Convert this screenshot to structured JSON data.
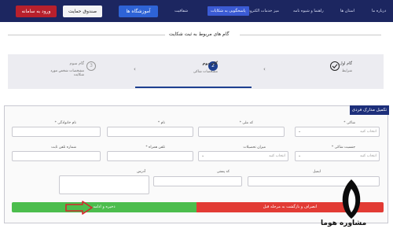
{
  "nav": {
    "login_label": "ورود به سامانه",
    "fund_label": "صندوق حمایت",
    "edu_label": "آموزشگاه ها",
    "links": [
      "درباره ما",
      "استان ها",
      "راهنما و شیوه نامه",
      "میز خدمات الکترونیکی",
      "پاسخگویی به شکایات",
      "شفافیت"
    ]
  },
  "section_title": "گام های مربوط به ثبت شکایت",
  "steps": [
    {
      "number": "",
      "title": "گام اول",
      "desc": "شرایط",
      "state": "done"
    },
    {
      "number": "2",
      "title": "گام دوم",
      "desc": "مشخصات شاکی",
      "state": "active"
    },
    {
      "number": "3",
      "title": "گام سوم",
      "desc": "مشخصات شخص مورد شکایت",
      "state": "pending"
    }
  ],
  "panel_title": "تکمیل مدارک فردی",
  "form": {
    "shaki_label": "* شاکی",
    "shaki_placeholder": "انتخاب کنید",
    "national_label": "* کد ملی",
    "name_label": "* نام",
    "family_label": "* نام خانوادگی",
    "gender_label": "* جنسیت شاکی",
    "gender_placeholder": "انتخاب کنید",
    "education_label": "میزان تحصیلات",
    "education_placeholder": "انتخاب کنید",
    "mobile_label": "* تلفن همراه",
    "phone_label": "شماره تلفن ثابت",
    "email_label": "ایمیل",
    "postal_label": "کد پستی",
    "address_label": "آدرس"
  },
  "buttons": {
    "cancel_label": "انصراف و بازگشت به مرحله قبل",
    "save_label": "ذخیره و ادامه"
  },
  "colors": {
    "nav_bg": "#1c2660",
    "accent": "#1d2f7a",
    "cancel": "#e23b34",
    "save": "#4cbd4d"
  },
  "logo": {
    "text": "مشاوره هوما"
  }
}
